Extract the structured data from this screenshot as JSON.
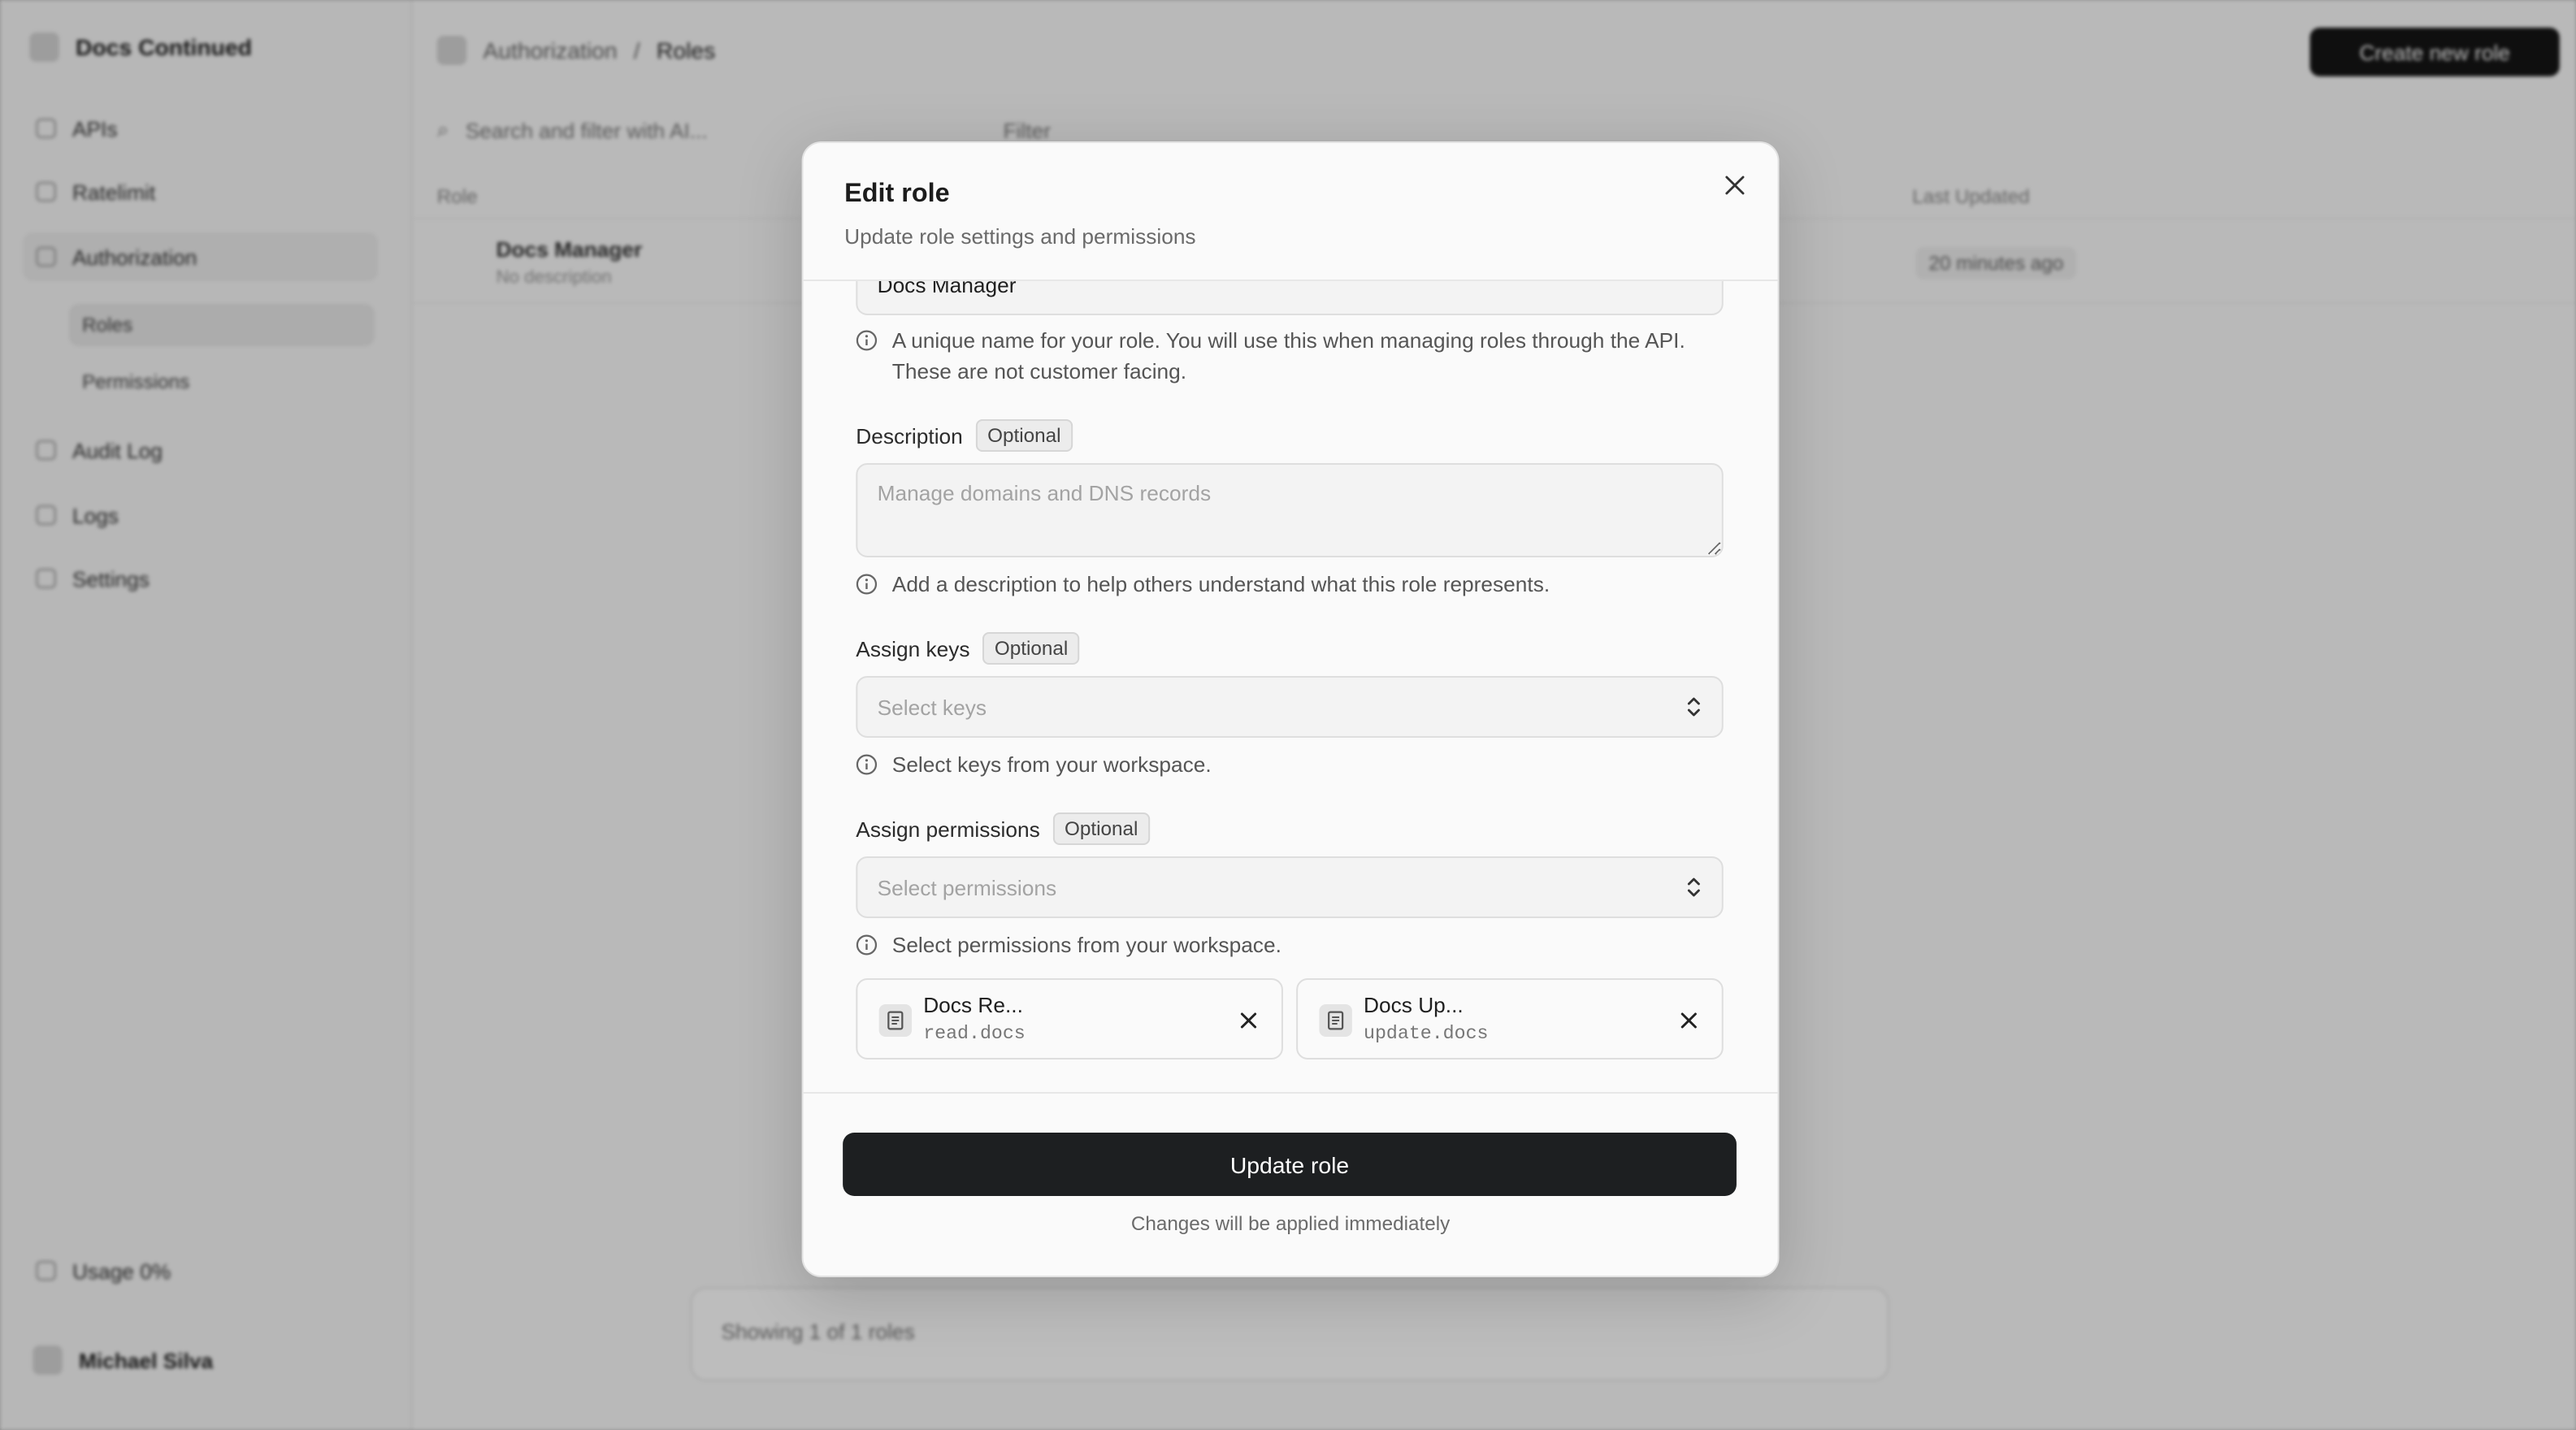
{
  "background": {
    "workspace": "Docs Continued",
    "nav": [
      {
        "label": "APIs",
        "icon": "api-icon"
      },
      {
        "label": "Ratelimit",
        "icon": "gauge-icon"
      },
      {
        "label": "Authorization",
        "icon": "shield-icon"
      },
      {
        "label": "Audit Log",
        "icon": "list-icon"
      },
      {
        "label": "Logs",
        "icon": "terminal-icon"
      },
      {
        "label": "Settings",
        "icon": "gear-icon"
      }
    ],
    "subnav": [
      "Roles",
      "Permissions"
    ],
    "breadcrumb": [
      "Authorization",
      "Roles"
    ],
    "create_button": "Create new role",
    "search_placeholder": "Search and filter with AI...",
    "filter_label": "Filter",
    "columns": [
      "Role",
      "Last Updated"
    ],
    "row": {
      "name": "Docs Manager",
      "desc": "No description",
      "updated": "20 minutes ago"
    },
    "footer": "Showing 1 of 1 roles",
    "usage": "Usage 0%",
    "user": "Michael Silva"
  },
  "modal": {
    "title": "Edit role",
    "subtitle": "Update role settings and permissions",
    "name_value": "Docs Manager",
    "name_help": "A unique name for your role. You will use this when managing roles through the API. These are not customer facing.",
    "description": {
      "label": "Description",
      "badge": "Optional",
      "placeholder": "Manage domains and DNS records",
      "help": "Add a description to help others understand what this role represents."
    },
    "keys": {
      "label": "Assign keys",
      "badge": "Optional",
      "placeholder": "Select keys",
      "help": "Select keys from your workspace."
    },
    "permissions": {
      "label": "Assign permissions",
      "badge": "Optional",
      "placeholder": "Select permissions",
      "help": "Select permissions from your workspace.",
      "selected": [
        {
          "name": "Docs Re...",
          "slug": "read.docs"
        },
        {
          "name": "Docs Up...",
          "slug": "update.docs"
        }
      ]
    },
    "submit_label": "Update role",
    "footer_note": "Changes will be applied immediately"
  }
}
